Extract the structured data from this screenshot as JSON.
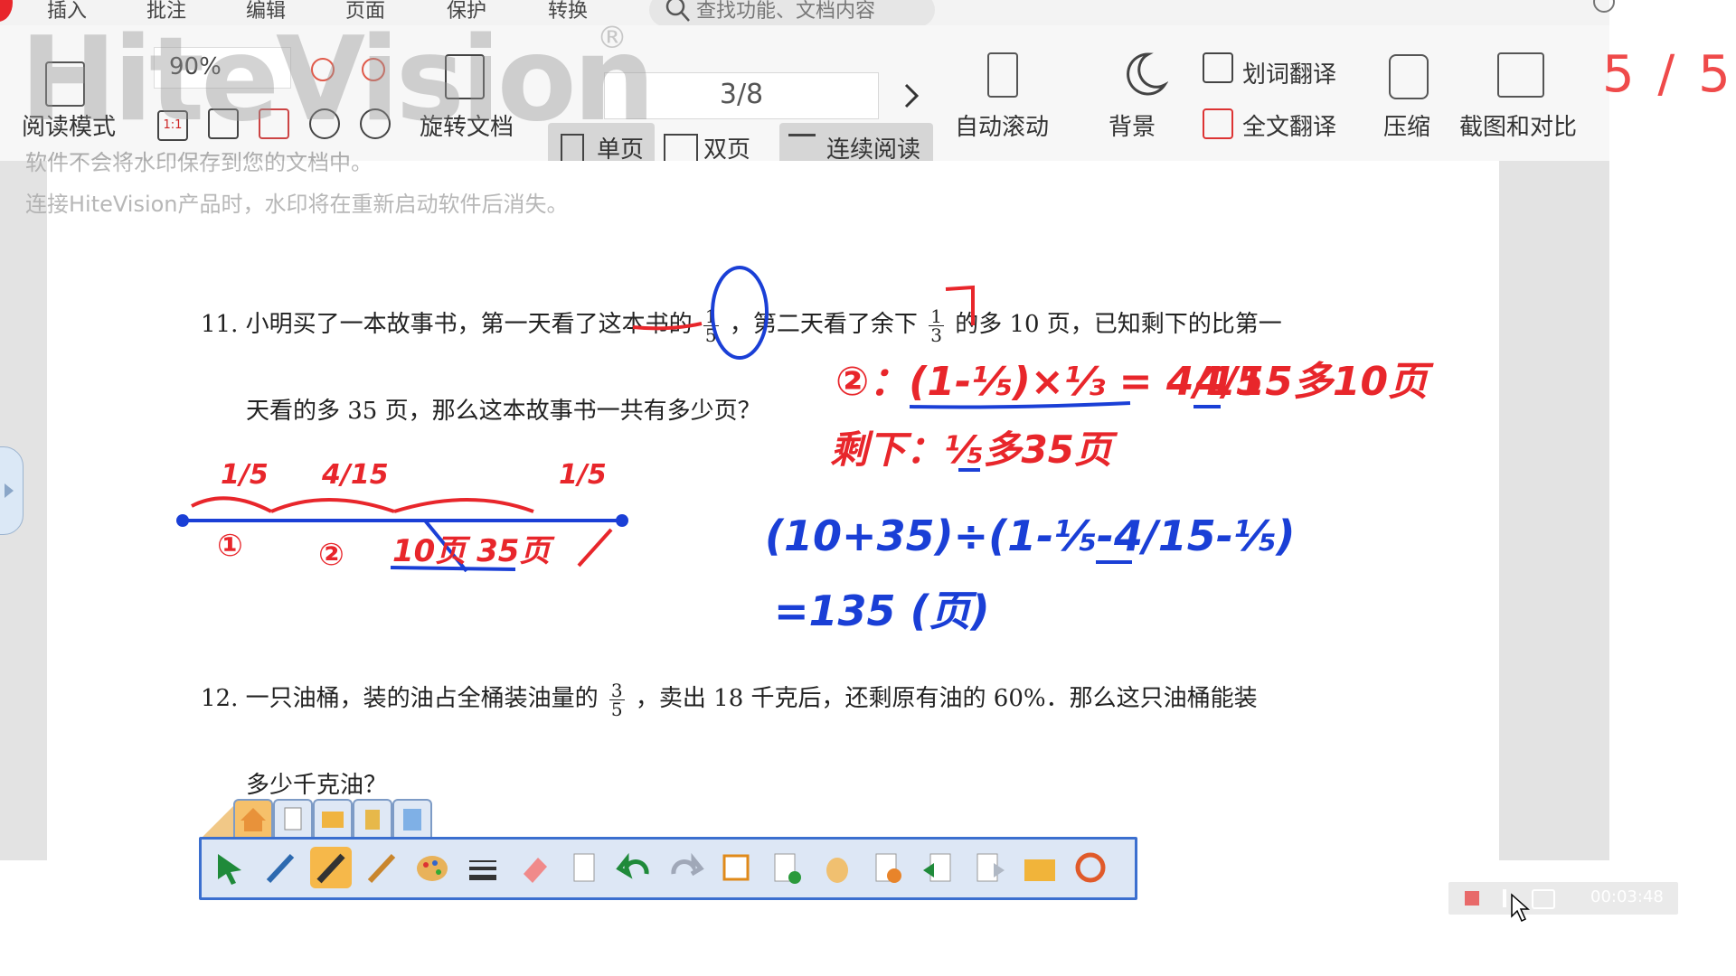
{
  "menubar": {
    "items": [
      "插入",
      "批注",
      "编辑",
      "页面",
      "保护",
      "转换"
    ],
    "search_placeholder": "查找功能、文档内容"
  },
  "toolbar": {
    "reading_mode": "阅读模式",
    "zoom_value": "90%",
    "rotate_doc": "旋转文档",
    "page_input": "3/8",
    "single_page": "单页",
    "double_page": "双页",
    "continuous_reading": "连续阅读",
    "auto_scroll": "自动滚动",
    "background": "背景",
    "word_translate": "划词翻译",
    "full_translate": "全文翻译",
    "compress": "压缩",
    "screenshot_compare": "截图和对比"
  },
  "watermark": {
    "brand": "HiteVision",
    "reg_mark": "®",
    "note1": "软件不会将水印保存到您的文档中。",
    "note2": "连接HiteVision产品时，水印将在重新启动软件后消失。"
  },
  "page_counter": "5 / 5",
  "document": {
    "q11_number": "11.",
    "q11_part1": "小明买了一本故事书，第一天看了这本书的",
    "q11_frac1_num": "1",
    "q11_frac1_den": "5",
    "q11_part2": "，第二天看了余下",
    "q11_frac2_num": "1",
    "q11_frac2_den": "3",
    "q11_part3": "的多 10 页，已知剩下的比第一",
    "q11_line2": "天看的多 35 页，那么这本故事书一共有多少页？",
    "q12_number": "12.",
    "q12_part1": "一只油桶，装的油占全桶装油量的",
    "q12_frac_num": "3",
    "q12_frac_den": "5",
    "q12_part2": "，卖出 18 千克后，还剩原有油的 60%．那么这只油桶能装",
    "q12_line2": "多少千克油？"
  },
  "handwriting": {
    "red_eq1": "②：(1-⅕)×⅓ = 4/15",
    "red_note1": "4/15多10页",
    "red_eq2": "剩下：⅕多35页",
    "seg1": "1/5",
    "seg2": "4/15",
    "seg3": "1/5",
    "mark1": "①",
    "mark2": "②",
    "mark3": "10页 35页",
    "blue_eq1": "(10+35)÷(1-⅕-4/15-⅕)",
    "blue_eq2": "=135 (页)"
  },
  "pen_toolbar": {
    "tabs": [
      "home-tab-icon",
      "page-tab-icon",
      "folder-tab-icon",
      "tools-tab-icon",
      "export-tab-icon"
    ],
    "tools": [
      "select-arrow-icon",
      "smart-pen-icon",
      "hard-pen-icon",
      "brush-icon",
      "palette-icon",
      "line-style-icon",
      "eraser-icon",
      "clear-page-icon",
      "undo-icon",
      "redo-icon",
      "edit-note-icon",
      "new-page-icon",
      "hand-pan-icon",
      "play-page-icon",
      "prev-page-icon",
      "next-page-icon",
      "open-folder-icon",
      "refresh-icon"
    ]
  },
  "recorder": {
    "time": "00:03:48"
  },
  "colors": {
    "red_ink": "#e8262b",
    "blue_ink": "#1a3fd6",
    "accent_counter": "#ef4a4a",
    "pen_toolbar_border": "#3b6fcf"
  }
}
